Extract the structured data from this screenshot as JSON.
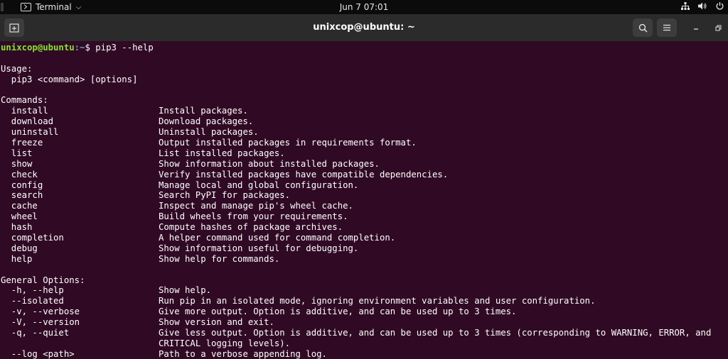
{
  "topbar": {
    "app_name": "Terminal",
    "app_menu_arrow": "⌵",
    "clock": "Jun 7  07:01",
    "tray_icons": [
      "network-icon",
      "volume-icon",
      "power-icon"
    ]
  },
  "window": {
    "title": "unixcop@ubuntu: ~"
  },
  "terminal": {
    "prompt_user": "unixcop@ubuntu",
    "prompt_path": ":~",
    "prompt_symbol": "$ ",
    "command": "pip3 --help",
    "usage_header": "Usage:",
    "usage_line": "  pip3 <command> [options]",
    "commands_header": "Commands:",
    "commands": [
      {
        "name": "  install",
        "desc": "Install packages."
      },
      {
        "name": "  download",
        "desc": "Download packages."
      },
      {
        "name": "  uninstall",
        "desc": "Uninstall packages."
      },
      {
        "name": "  freeze",
        "desc": "Output installed packages in requirements format."
      },
      {
        "name": "  list",
        "desc": "List installed packages."
      },
      {
        "name": "  show",
        "desc": "Show information about installed packages."
      },
      {
        "name": "  check",
        "desc": "Verify installed packages have compatible dependencies."
      },
      {
        "name": "  config",
        "desc": "Manage local and global configuration."
      },
      {
        "name": "  search",
        "desc": "Search PyPI for packages."
      },
      {
        "name": "  cache",
        "desc": "Inspect and manage pip's wheel cache."
      },
      {
        "name": "  wheel",
        "desc": "Build wheels from your requirements."
      },
      {
        "name": "  hash",
        "desc": "Compute hashes of package archives."
      },
      {
        "name": "  completion",
        "desc": "A helper command used for command completion."
      },
      {
        "name": "  debug",
        "desc": "Show information useful for debugging."
      },
      {
        "name": "  help",
        "desc": "Show help for commands."
      }
    ],
    "options_header": "General Options:",
    "options": [
      {
        "name": "  -h, --help",
        "desc": "Show help."
      },
      {
        "name": "  --isolated",
        "desc": "Run pip in an isolated mode, ignoring environment variables and user configuration."
      },
      {
        "name": "  -v, --verbose",
        "desc": "Give more output. Option is additive, and can be used up to 3 times."
      },
      {
        "name": "  -V, --version",
        "desc": "Show version and exit."
      },
      {
        "name": "  -q, --quiet",
        "desc": "Give less output. Option is additive, and can be used up to 3 times (corresponding to WARNING, ERROR, and"
      },
      {
        "name": "",
        "desc": "CRITICAL logging levels)."
      },
      {
        "name": "  --log <path>",
        "desc": "Path to a verbose appending log."
      }
    ]
  },
  "colors": {
    "terminal_bg": "#300a24",
    "prompt_user": "#8ae234",
    "prompt_path": "#729fcf"
  }
}
